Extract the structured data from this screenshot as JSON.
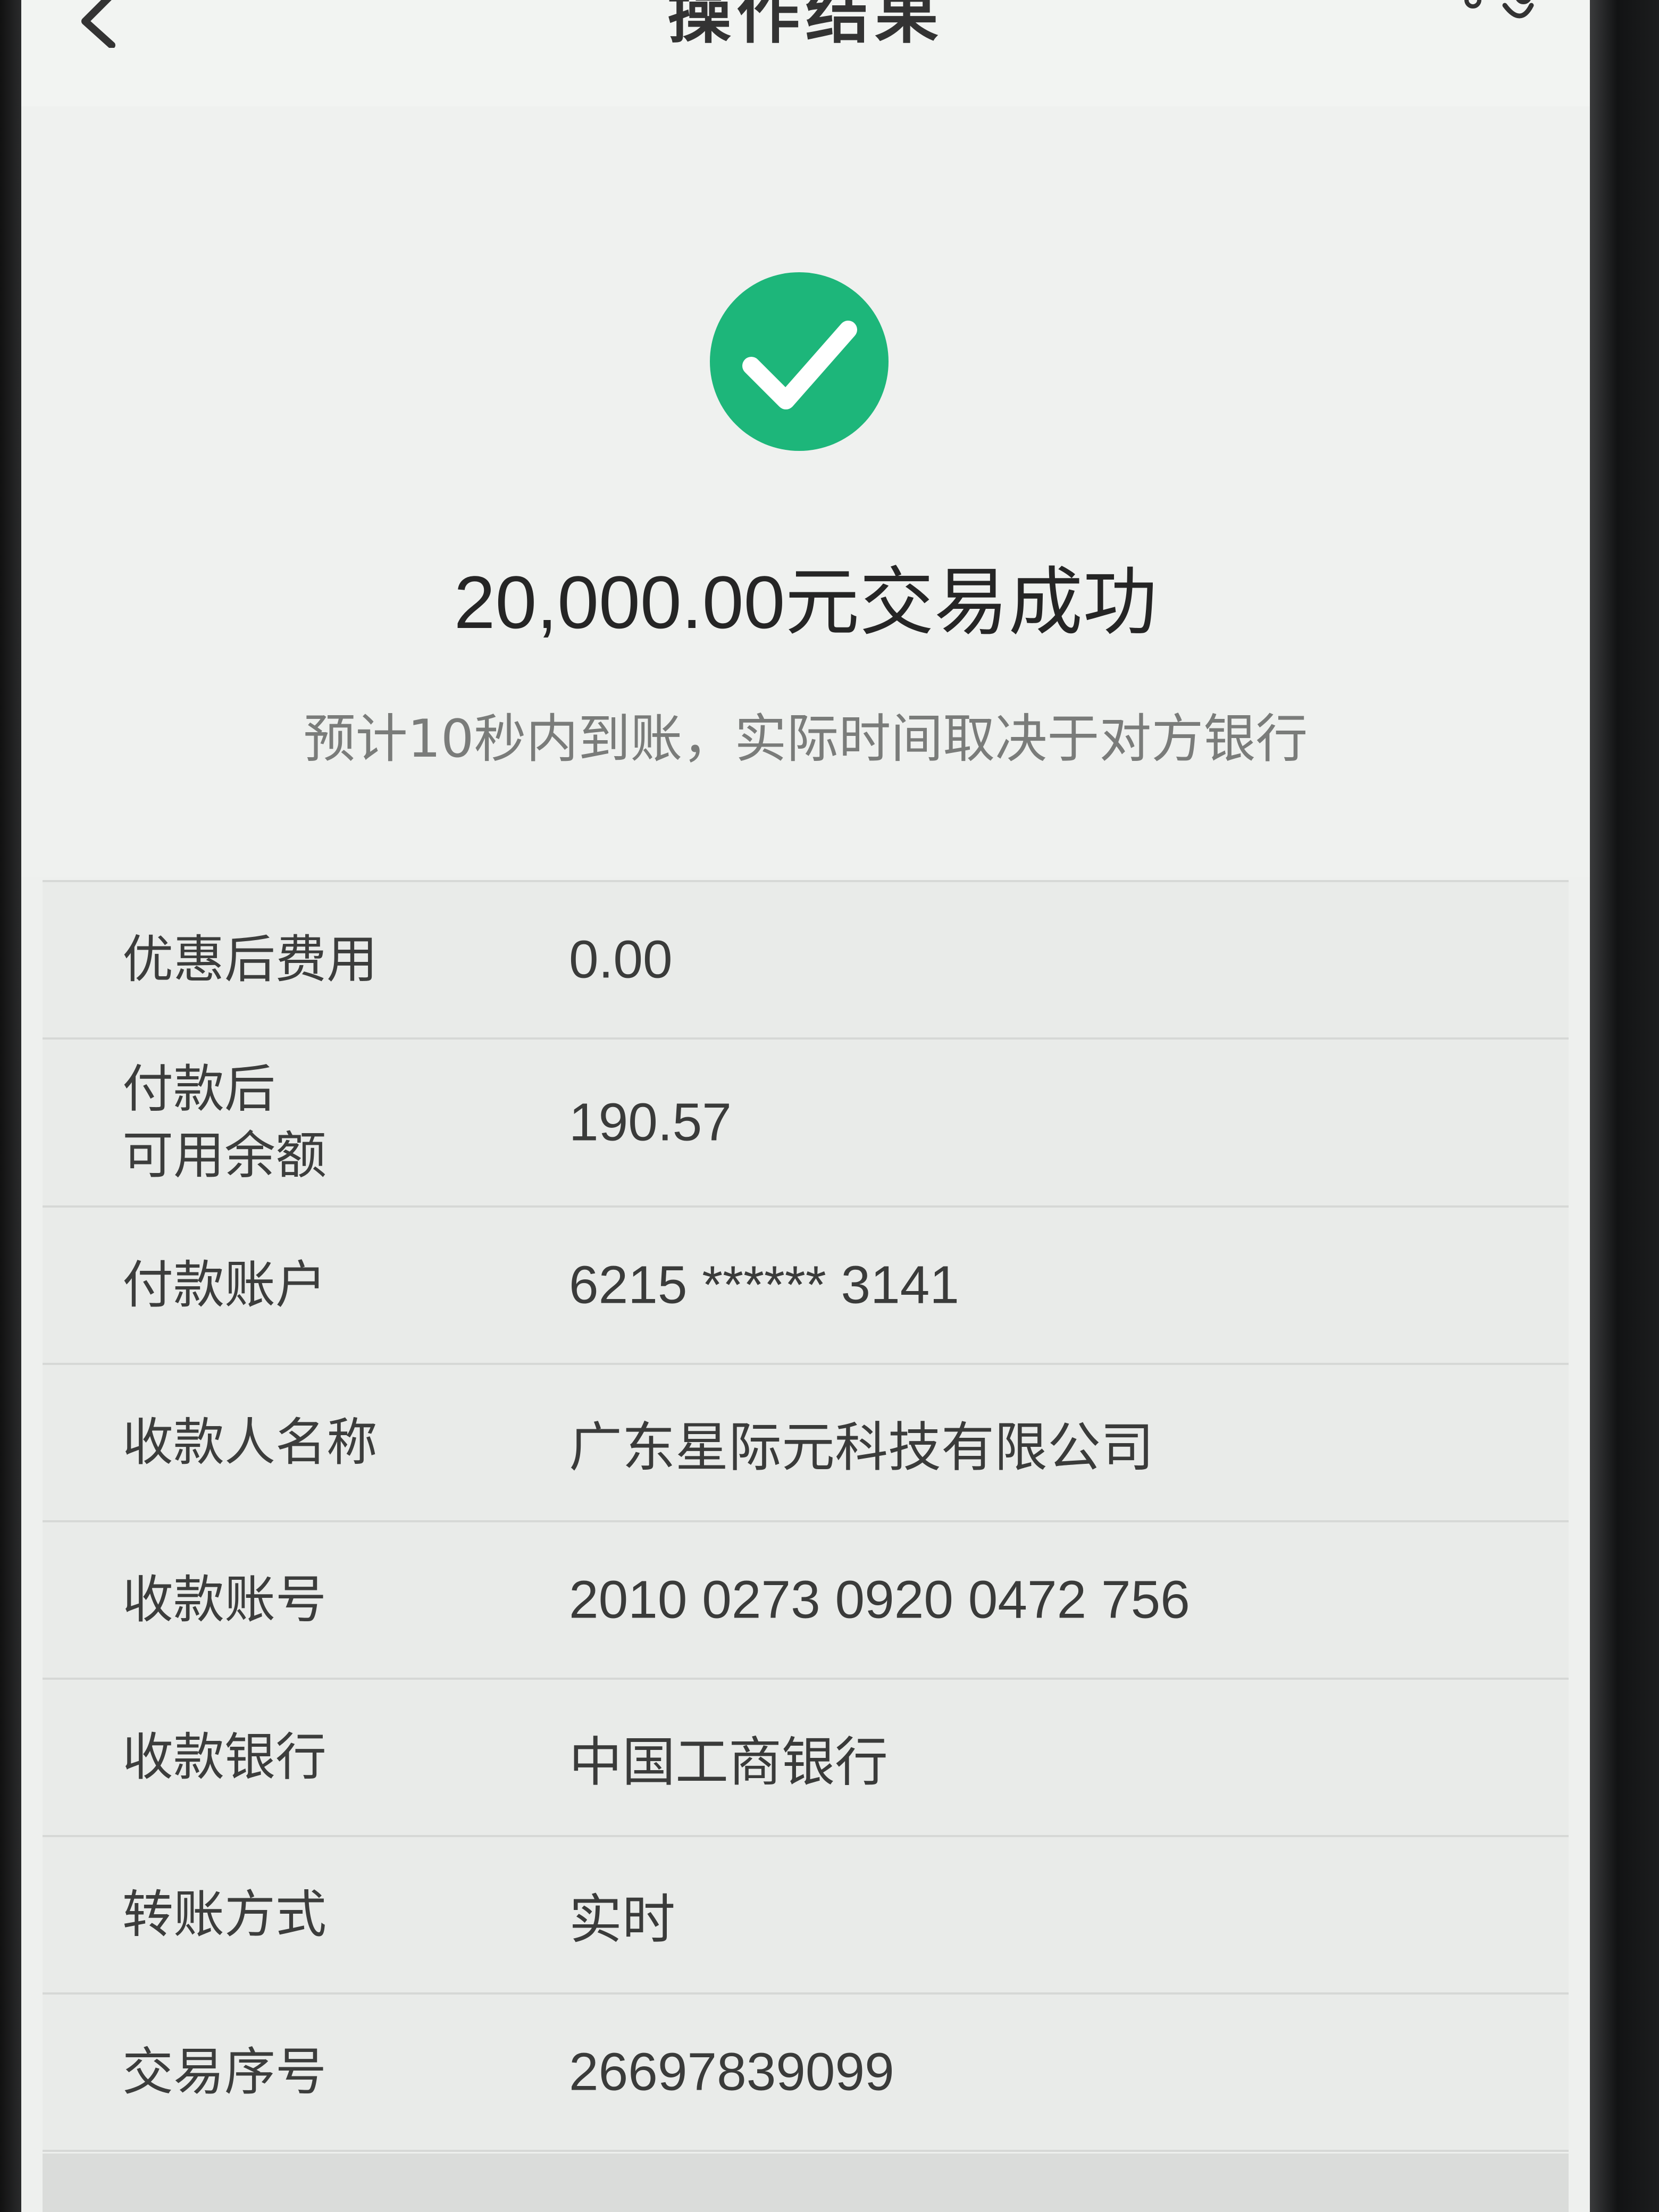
{
  "nav": {
    "title": "操作结果",
    "back_icon": "chevron-left-icon",
    "more_icon": "more-icon"
  },
  "result": {
    "icon": "check-circle-icon",
    "icon_color": "#1db67a",
    "title": "20,000.00元交易成功",
    "subtitle": "预计10秒内到账，实际时间取决于对方银行"
  },
  "details": [
    {
      "label": "优惠后费用",
      "value": "0.00"
    },
    {
      "label": "付款后\n可用余额",
      "value": "190.57"
    },
    {
      "label": "付款账户",
      "value": "6215 ****** 3141"
    },
    {
      "label": "收款人名称",
      "value": "广东星际元科技有限公司"
    },
    {
      "label": "收款账号",
      "value": "2010 0273 0920 0472 756"
    },
    {
      "label": "收款银行",
      "value": "中国工商银行"
    },
    {
      "label": "转账方式",
      "value": "实时"
    },
    {
      "label": "交易序号",
      "value": "26697839099"
    }
  ]
}
